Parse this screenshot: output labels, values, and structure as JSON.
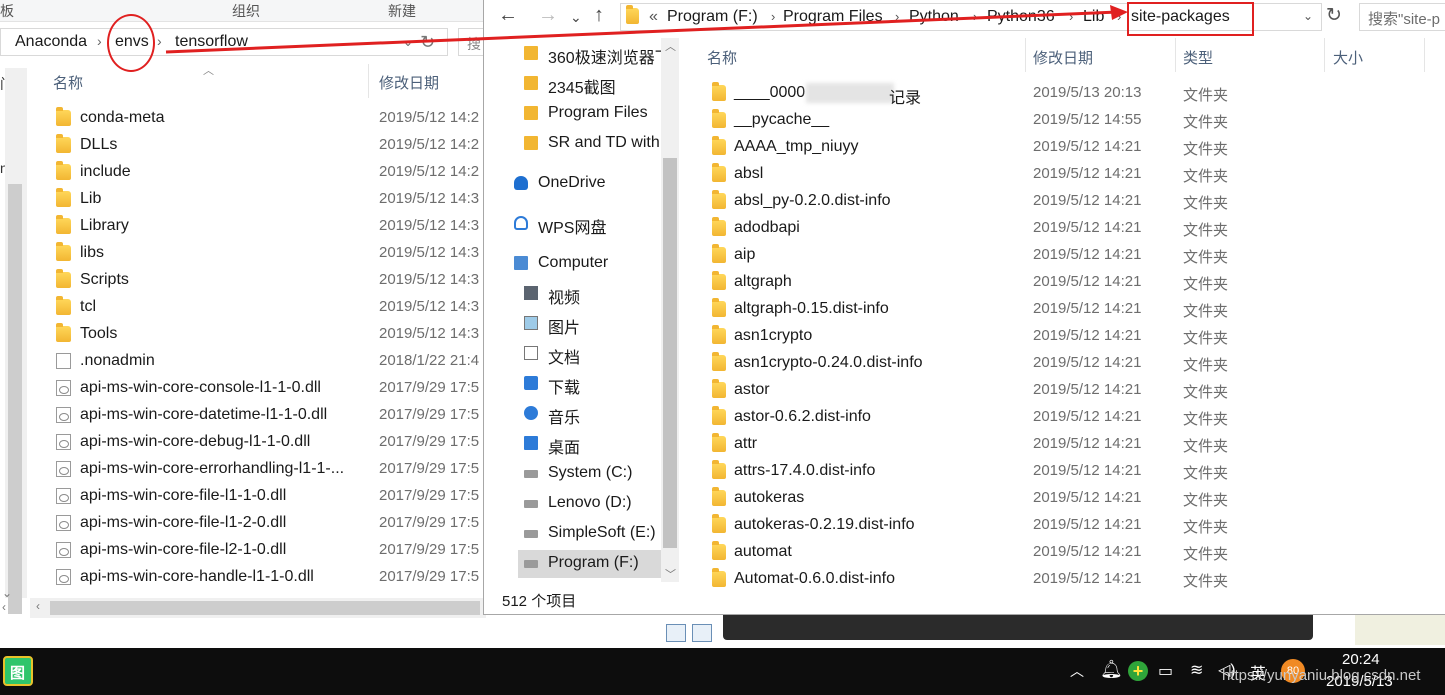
{
  "back_window": {
    "ribbon": {
      "left_fragment": "板",
      "group_label": "组织",
      "new_label": "新建"
    },
    "address": {
      "crumbs": [
        "Anaconda",
        "envs",
        "tensorflow"
      ]
    },
    "search_fragment": "搜",
    "nav_fragments": [
      "门",
      "n"
    ],
    "columns": {
      "name": "名称",
      "modified": "修改日期"
    },
    "rows": [
      {
        "name": "conda-meta",
        "date": "2019/5/12 14:2",
        "kind": "folder"
      },
      {
        "name": "DLLs",
        "date": "2019/5/12 14:2",
        "kind": "folder"
      },
      {
        "name": "include",
        "date": "2019/5/12 14:2",
        "kind": "folder"
      },
      {
        "name": "Lib",
        "date": "2019/5/12 14:3",
        "kind": "folder"
      },
      {
        "name": "Library",
        "date": "2019/5/12 14:3",
        "kind": "folder"
      },
      {
        "name": "libs",
        "date": "2019/5/12 14:3",
        "kind": "folder"
      },
      {
        "name": "Scripts",
        "date": "2019/5/12 14:3",
        "kind": "folder"
      },
      {
        "name": "tcl",
        "date": "2019/5/12 14:3",
        "kind": "folder"
      },
      {
        "name": "Tools",
        "date": "2019/5/12 14:3",
        "kind": "folder"
      },
      {
        "name": ".nonadmin",
        "date": "2018/1/22 21:4",
        "kind": "file"
      },
      {
        "name": "api-ms-win-core-console-l1-1-0.dll",
        "date": "2017/9/29 17:5",
        "kind": "dll"
      },
      {
        "name": "api-ms-win-core-datetime-l1-1-0.dll",
        "date": "2017/9/29 17:5",
        "kind": "dll"
      },
      {
        "name": "api-ms-win-core-debug-l1-1-0.dll",
        "date": "2017/9/29 17:5",
        "kind": "dll"
      },
      {
        "name": "api-ms-win-core-errorhandling-l1-1-...",
        "date": "2017/9/29 17:5",
        "kind": "dll"
      },
      {
        "name": "api-ms-win-core-file-l1-1-0.dll",
        "date": "2017/9/29 17:5",
        "kind": "dll"
      },
      {
        "name": "api-ms-win-core-file-l1-2-0.dll",
        "date": "2017/9/29 17:5",
        "kind": "dll"
      },
      {
        "name": "api-ms-win-core-file-l2-1-0.dll",
        "date": "2017/9/29 17:5",
        "kind": "dll"
      },
      {
        "name": "api-ms-win-core-handle-l1-1-0.dll",
        "date": "2017/9/29 17:5",
        "kind": "dll"
      }
    ]
  },
  "front_window": {
    "address": {
      "overflow": "«",
      "crumbs": [
        "Program (F:)",
        "Program Files",
        "Python",
        "Python36",
        "Lib",
        "site-packages"
      ]
    },
    "search_placeholder": "搜索\"site-p",
    "nav": [
      {
        "label": "360极速浏览器下",
        "icon": "folder-icon"
      },
      {
        "label": "2345截图",
        "icon": "folder-icon"
      },
      {
        "label": "Program Files",
        "icon": "folder-icon"
      },
      {
        "label": "SR and TD with",
        "icon": "folder-icon"
      },
      {
        "label": "OneDrive",
        "icon": "cloud-icon"
      },
      {
        "label": "WPS网盘",
        "icon": "cloud-outline-icon"
      },
      {
        "label": "Computer",
        "icon": "computer-icon"
      },
      {
        "label": "视频",
        "icon": "video-icon"
      },
      {
        "label": "图片",
        "icon": "pictures-icon"
      },
      {
        "label": "文档",
        "icon": "documents-icon"
      },
      {
        "label": "下载",
        "icon": "download-icon"
      },
      {
        "label": "音乐",
        "icon": "music-icon"
      },
      {
        "label": "桌面",
        "icon": "desktop-icon"
      },
      {
        "label": "System (C:)",
        "icon": "drive-icon"
      },
      {
        "label": "Lenovo (D:)",
        "icon": "drive-icon"
      },
      {
        "label": "SimpleSoft (E:)",
        "icon": "drive-icon"
      },
      {
        "label": "Program (F:)",
        "icon": "drive-icon"
      }
    ],
    "columns": {
      "name": "名称",
      "modified": "修改日期",
      "type": "类型",
      "size": "大小"
    },
    "rows": [
      {
        "name": "____0000",
        "suffix": "记录",
        "date": "2019/5/13 20:13",
        "type": "文件夹"
      },
      {
        "name": "__pycache__",
        "date": "2019/5/12 14:55",
        "type": "文件夹"
      },
      {
        "name": "AAAA_tmp_niuyy",
        "date": "2019/5/12 14:21",
        "type": "文件夹"
      },
      {
        "name": "absl",
        "date": "2019/5/12 14:21",
        "type": "文件夹"
      },
      {
        "name": "absl_py-0.2.0.dist-info",
        "date": "2019/5/12 14:21",
        "type": "文件夹"
      },
      {
        "name": "adodbapi",
        "date": "2019/5/12 14:21",
        "type": "文件夹"
      },
      {
        "name": "aip",
        "date": "2019/5/12 14:21",
        "type": "文件夹"
      },
      {
        "name": "altgraph",
        "date": "2019/5/12 14:21",
        "type": "文件夹"
      },
      {
        "name": "altgraph-0.15.dist-info",
        "date": "2019/5/12 14:21",
        "type": "文件夹"
      },
      {
        "name": "asn1crypto",
        "date": "2019/5/12 14:21",
        "type": "文件夹"
      },
      {
        "name": "asn1crypto-0.24.0.dist-info",
        "date": "2019/5/12 14:21",
        "type": "文件夹"
      },
      {
        "name": "astor",
        "date": "2019/5/12 14:21",
        "type": "文件夹"
      },
      {
        "name": "astor-0.6.2.dist-info",
        "date": "2019/5/12 14:21",
        "type": "文件夹"
      },
      {
        "name": "attr",
        "date": "2019/5/12 14:21",
        "type": "文件夹"
      },
      {
        "name": "attrs-17.4.0.dist-info",
        "date": "2019/5/12 14:21",
        "type": "文件夹"
      },
      {
        "name": "autokeras",
        "date": "2019/5/12 14:21",
        "type": "文件夹"
      },
      {
        "name": "autokeras-0.2.19.dist-info",
        "date": "2019/5/12 14:21",
        "type": "文件夹"
      },
      {
        "name": "automat",
        "date": "2019/5/12 14:21",
        "type": "文件夹"
      },
      {
        "name": "Automat-0.6.0.dist-info",
        "date": "2019/5/12 14:21",
        "type": "文件夹"
      }
    ],
    "status": "512 个项目"
  },
  "taskbar": {
    "app_glyph": "图",
    "ime": "英",
    "badge": "80",
    "time": "20:24",
    "date": "2019/5/13",
    "watermark": "https://yunyaniu.blog.csdn.net"
  },
  "colors": {
    "annotation_red": "#e02020",
    "folder_yellow": "#f2b632",
    "header_text": "#4c607a"
  }
}
